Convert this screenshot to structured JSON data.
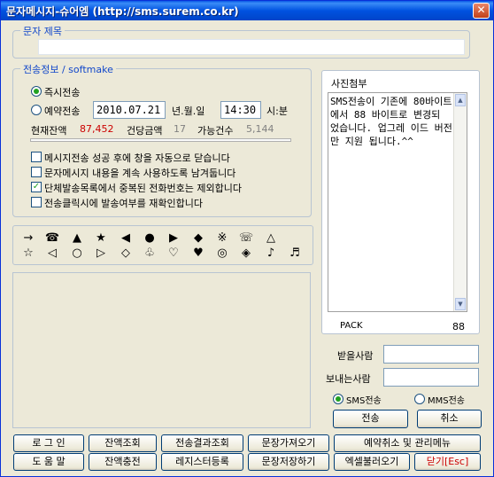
{
  "window": {
    "title": "문자메시지-슈어엠 (http://sms.surem.co.kr)",
    "close_glyph": "✕"
  },
  "subject": {
    "legend": "문자 제목",
    "value": ""
  },
  "send_info": {
    "legend": "전송정보 / softmake",
    "immediate_label": "즉시전송",
    "reserve_label": "예약전송",
    "date_value": "2010.07.21",
    "date_unit": "년.월.일",
    "time_value": "14:30",
    "time_unit": "시:분",
    "balance_label": "현재잔액",
    "balance_value": "87,452",
    "unit_price_label": "건당금액",
    "unit_price_value": "17",
    "available_label": "가능건수",
    "available_value": "5,144",
    "progress_fraction": 0
  },
  "options": [
    {
      "label": "메시지전송 성공 후에 창을 자동으로 닫습니다",
      "checked": false
    },
    {
      "label": "문자메시지 내용을 계속 사용하도록 남겨둡니다",
      "checked": false
    },
    {
      "label": "단체발송목록에서 중복된 전화번호는 제외합니다",
      "checked": true
    },
    {
      "label": "전송클릭시에 발송여부를 재확인합니다",
      "checked": false
    }
  ],
  "symbols": {
    "row1": [
      "→",
      "☎",
      "▲",
      "★",
      "◀",
      "●",
      "▶",
      "◆",
      "※",
      "☏",
      "△"
    ],
    "row2": [
      "☆",
      "◁",
      "○",
      "▷",
      "◇",
      "♧",
      "♡",
      "♥",
      "◎",
      "◈",
      "♪",
      "♬"
    ]
  },
  "photo": {
    "legend": "사진첨부",
    "message": "SMS전송이 기존에 80바이트에서 88 바이트로 변경되 었습니다. 업그레 이드 버전만 지원 됩니다.^^",
    "pack_label": "PACK",
    "pack_value": "88"
  },
  "recipient_label": "받을사람",
  "sender_label": "보내는사람",
  "recipient_value": "",
  "sender_value": "",
  "mode": {
    "sms_label": "SMS전송",
    "mms_label": "MMS전송",
    "selected": "SMS전송"
  },
  "actions": {
    "send": "전송",
    "cancel": "취소"
  },
  "bottom_buttons": {
    "login": "로 그 인",
    "balance_check": "잔액조회",
    "result_check": "전송결과조회",
    "load_sentence": "문장가져오기",
    "reservation": "예약취소 및 관리메뉴",
    "help": "도 움 말",
    "recharge": "잔액충전",
    "registry": "레지스터등록",
    "save_sentence": "문장저장하기",
    "excel": "엑셀불러오기",
    "close": "닫기[Esc]"
  },
  "colors": {
    "balance": "#cc0000",
    "legend": "#1147ca",
    "close_label": "#cc0000"
  }
}
